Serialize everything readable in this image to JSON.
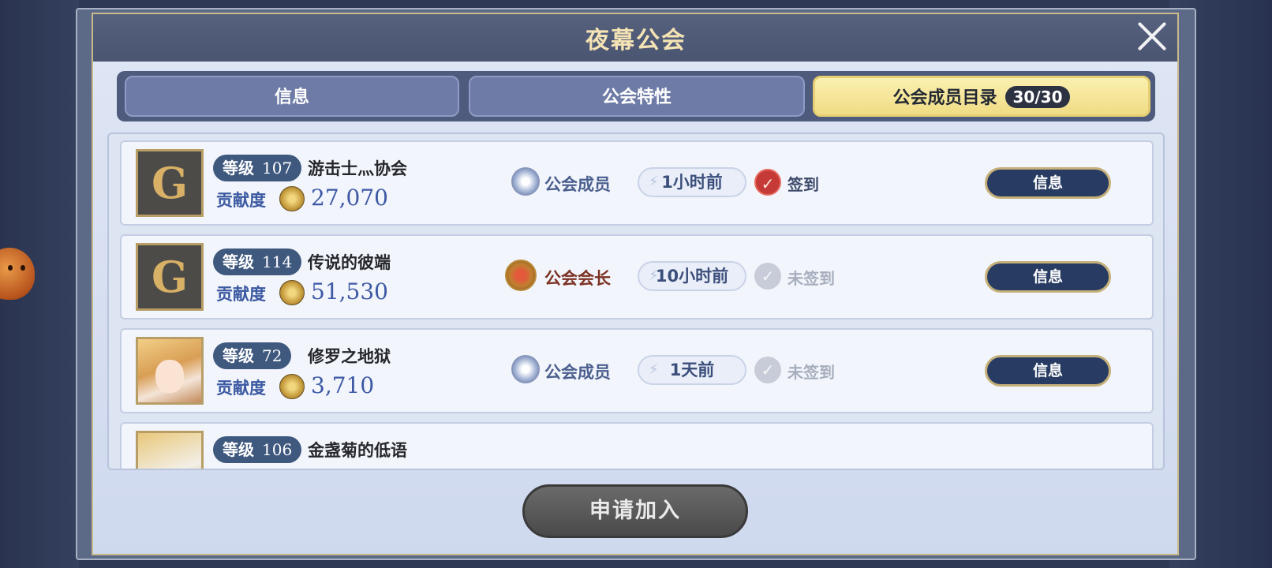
{
  "dialog": {
    "title": "夜幕公会"
  },
  "tabs": [
    {
      "label": "信息"
    },
    {
      "label": "公会特性"
    },
    {
      "label": "公会成员目录",
      "count": "30/30"
    }
  ],
  "members": [
    {
      "level_label": "等级",
      "level": "107",
      "name": "游击士灬协会",
      "contribution_label": "贡献度",
      "contribution": "27,070",
      "role": "公会成员",
      "last_online": "1小时前",
      "checkin": "签到",
      "info_button": "信息"
    },
    {
      "level_label": "等级",
      "level": "114",
      "name": "传说的彼端",
      "contribution_label": "贡献度",
      "contribution": "51,530",
      "role": "公会会长",
      "last_online": "10小时前",
      "checkin": "未签到",
      "info_button": "信息"
    },
    {
      "level_label": "等级",
      "level": "72",
      "name": "修罗之地狱",
      "contribution_label": "贡献度",
      "contribution": "3,710",
      "role": "公会成员",
      "last_online": "1天前",
      "checkin": "未签到",
      "info_button": "信息"
    },
    {
      "level_label": "等级",
      "level": "106",
      "name": "金盏菊的低语"
    }
  ],
  "apply_button": "申请加入",
  "colors": {
    "accent_gold": "#f0dc85",
    "button_navy": "#283c63",
    "contribution_blue": "#3d58a5"
  }
}
